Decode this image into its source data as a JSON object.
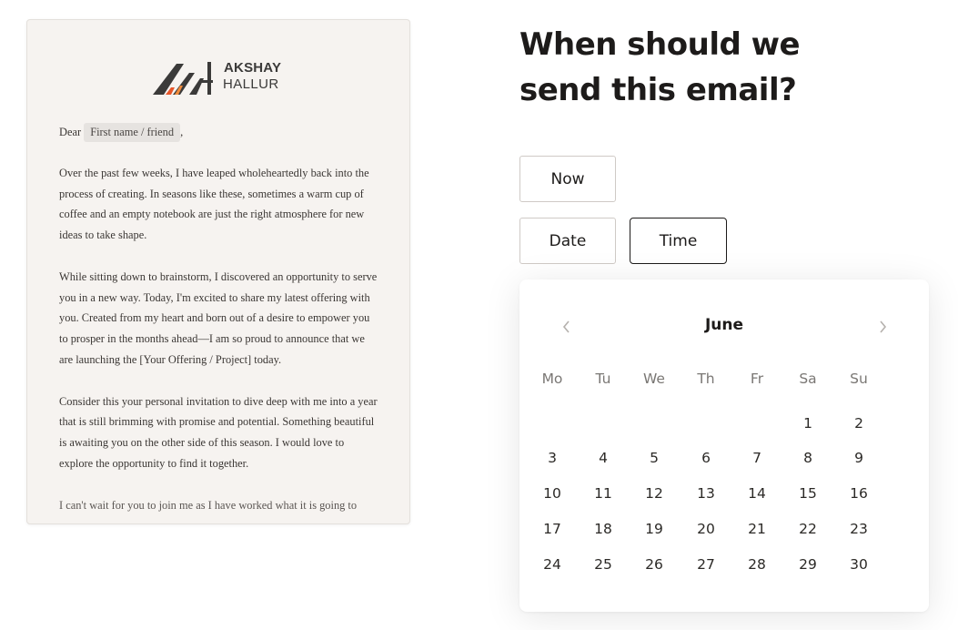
{
  "email": {
    "logo": {
      "name": "AKSHAY",
      "sub": "HALLUR"
    },
    "greeting_prefix": "Dear",
    "merge_tag": "First name / friend",
    "greeting_suffix": ",",
    "paragraphs": [
      "Over the past few weeks, I have leaped wholeheartedly back into the process of creating. In seasons like these, sometimes a warm cup of coffee and an empty notebook are just the right atmosphere for new ideas to take shape.",
      "While sitting down to brainstorm, I discovered an opportunity to serve you in a new way. Today, I'm excited to share my latest offering with you. Created from my heart and born out of a desire to empower you to prosper in the months ahead—I am so proud to announce that we are launching the [Your Offering / Project] today.",
      "Consider this your personal invitation to dive deep with me into a year that is still brimming with promise and potential. Something beautiful is awaiting you on the other side of this season. I would love to explore the opportunity to find it together."
    ],
    "cut_off_line": "I can't wait for you to join me as I have worked what it is going to"
  },
  "question": "When should we send this email?",
  "options": {
    "now": "Now",
    "date": "Date",
    "time": "Time"
  },
  "calendar": {
    "month": "June",
    "weekdays": [
      "Mo",
      "Tu",
      "We",
      "Th",
      "Fr",
      "Sa",
      "Su"
    ],
    "days": [
      "1",
      "2",
      "3",
      "4",
      "5",
      "6",
      "7",
      "8",
      "9",
      "10",
      "11",
      "12",
      "13",
      "14",
      "15",
      "16",
      "17",
      "18",
      "19",
      "20",
      "21",
      "22",
      "23",
      "24",
      "25",
      "26",
      "27",
      "28",
      "29",
      "30"
    ],
    "first_day_column": 5,
    "icons": {
      "prev": "chevron-left-icon",
      "next": "chevron-right-icon"
    }
  },
  "colors": {
    "card_bg": "#f6f3f0",
    "text": "#1d1b1a",
    "logo_orange": "#e8562a",
    "logo_dark": "#3b3a39"
  }
}
